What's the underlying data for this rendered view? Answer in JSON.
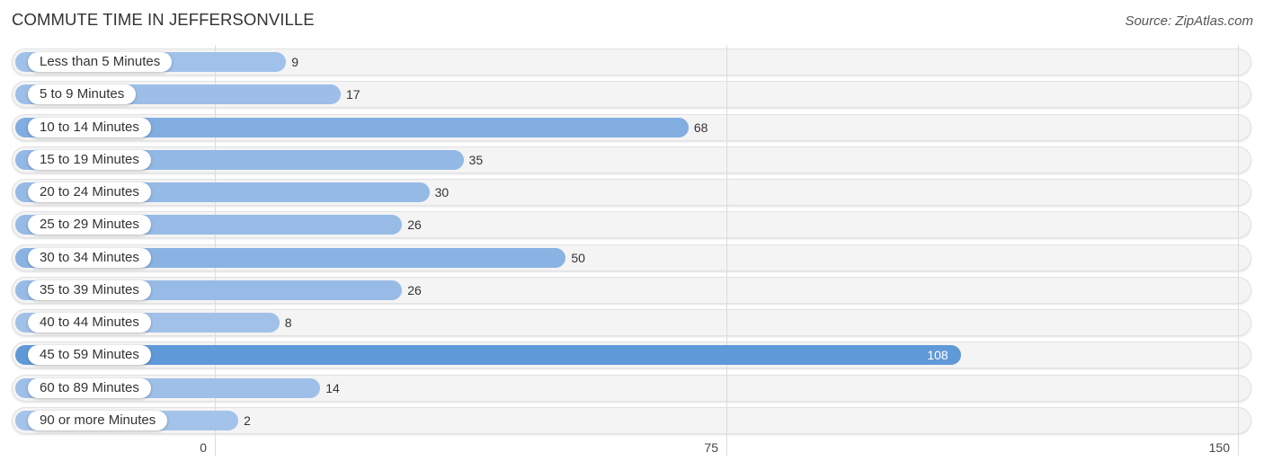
{
  "header": {
    "title": "COMMUTE TIME IN JEFFERSONVILLE",
    "source": "Source: ZipAtlas.com"
  },
  "colors": {
    "bar_light": "#a5c4ea",
    "bar_mid": "#8db5e4",
    "bar_max": "#6099d8",
    "row_bg": "#f4f4f4"
  },
  "chart_data": {
    "type": "bar",
    "orientation": "horizontal",
    "title": "COMMUTE TIME IN JEFFERSONVILLE",
    "xlabel": "",
    "ylabel": "",
    "xlim": [
      0,
      150
    ],
    "ticks": [
      0,
      75,
      150
    ],
    "tick_labels": [
      "0",
      "75",
      "150"
    ],
    "grid": true,
    "categories": [
      "Less than 5 Minutes",
      "5 to 9 Minutes",
      "10 to 14 Minutes",
      "15 to 19 Minutes",
      "20 to 24 Minutes",
      "25 to 29 Minutes",
      "30 to 34 Minutes",
      "35 to 39 Minutes",
      "40 to 44 Minutes",
      "45 to 59 Minutes",
      "60 to 89 Minutes",
      "90 or more Minutes"
    ],
    "values": [
      9,
      17,
      68,
      35,
      30,
      26,
      50,
      26,
      8,
      108,
      14,
      2
    ],
    "value_labels": [
      "9",
      "17",
      "68",
      "35",
      "30",
      "26",
      "50",
      "26",
      "8",
      "108",
      "14",
      "2"
    ]
  }
}
